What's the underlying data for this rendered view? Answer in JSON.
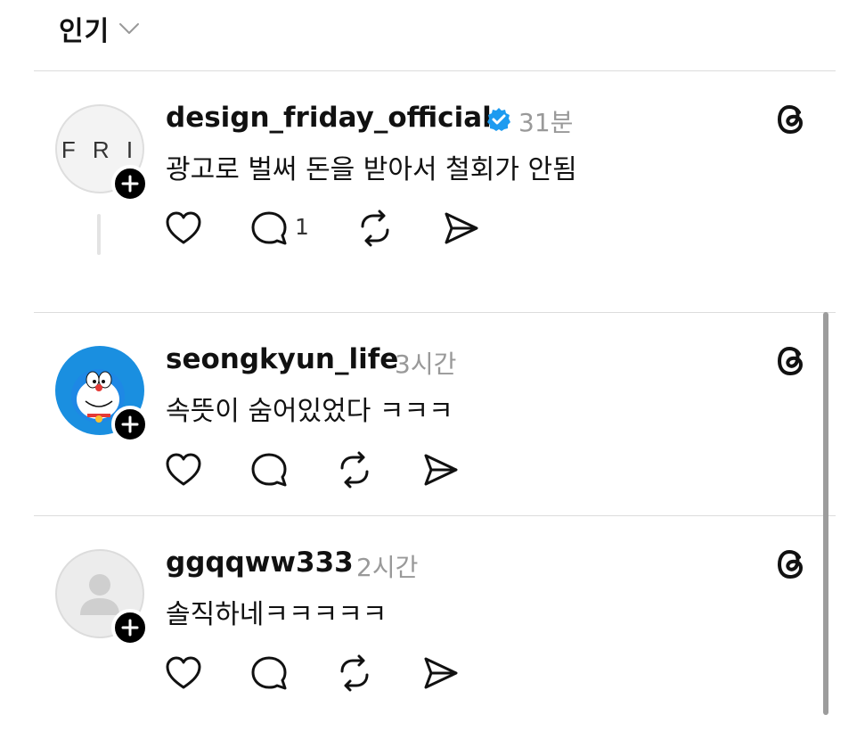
{
  "header": {
    "sort_label": "인기"
  },
  "posts": [
    {
      "username": "design_friday_official",
      "verified": true,
      "time": "31분",
      "text": "광고로 벌써 돈을 받아서 철회가 안됨",
      "reply_count": "1",
      "avatar_text": "F R I"
    },
    {
      "username": "seongkyun_life",
      "verified": false,
      "time": "3시간",
      "text": "속뜻이 숨어있었다 ㅋㅋㅋ"
    },
    {
      "username": "ggqqww333",
      "verified": false,
      "time": "2시간",
      "text": "솔직하네ㅋㅋㅋㅋㅋ"
    }
  ],
  "colors": {
    "verified": "#1d9bf0",
    "doraemon_blue": "#1a8fe0",
    "muted_text": "#999999"
  }
}
